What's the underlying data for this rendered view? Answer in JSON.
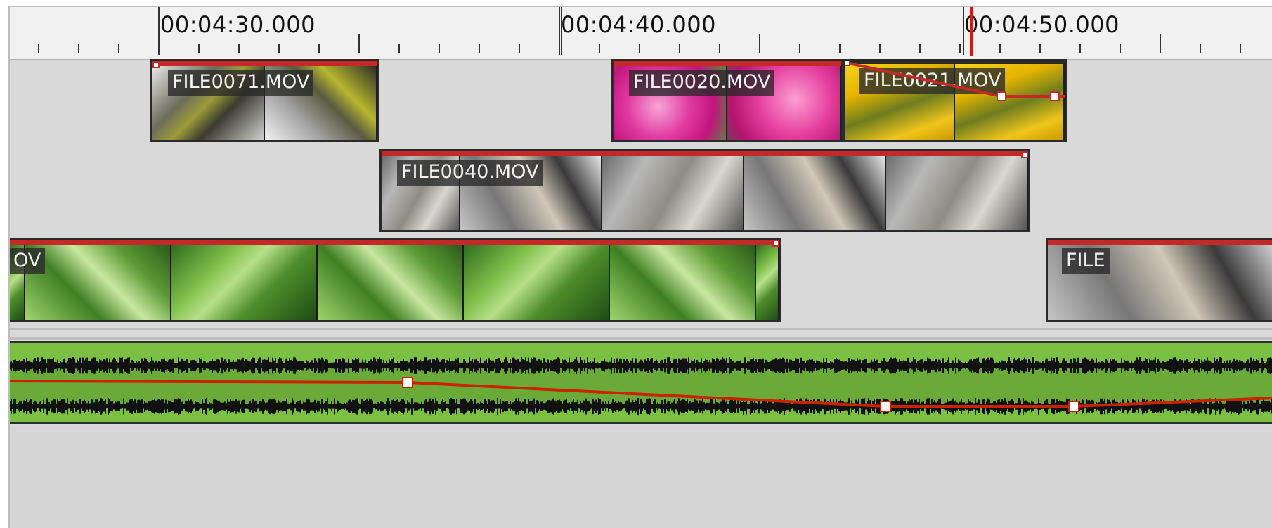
{
  "ruler": {
    "labels": [
      "00:04:30.000",
      "00:04:40.000",
      "00:04:50.000"
    ]
  },
  "clips": {
    "file0071": {
      "label": "FILE0071.MOV"
    },
    "file0020": {
      "label": "FILE0020.MOV"
    },
    "file0021": {
      "label": "FILE0021.MOV"
    },
    "file0040": {
      "label": "FILE0040.MOV"
    },
    "leaf_clip": {
      "label": "OV"
    },
    "edge_clip": {
      "label": "FILE"
    }
  },
  "colors": {
    "clip_topbar": "#c62828",
    "playhead": "#d01919",
    "audio_bg": "#7bc043",
    "waveform": "#111111",
    "keyframe_line": "#cc2200"
  },
  "icons": {
    "keyframe": "keyframe-handle-icon"
  }
}
